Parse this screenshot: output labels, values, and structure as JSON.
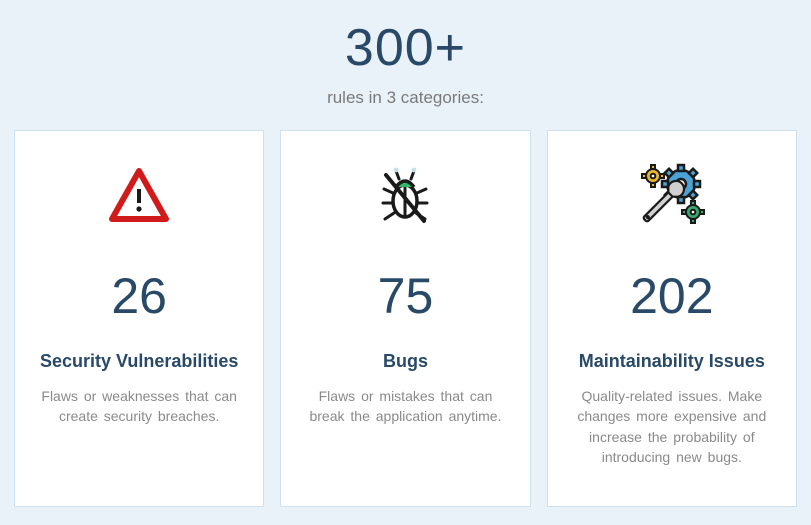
{
  "header": {
    "total": "300+",
    "subtitle": "rules in 3 categories:"
  },
  "cards": [
    {
      "icon": "warning-triangle-icon",
      "count": "26",
      "title": "Security Vulnerabilities",
      "desc": "Flaws or weaknesses that can create security breaches."
    },
    {
      "icon": "bug-crossed-icon",
      "count": "75",
      "title": "Bugs",
      "desc": "Flaws or mistakes that can break the application anytime."
    },
    {
      "icon": "wrench-gears-icon",
      "count": "202",
      "title": "Maintainability Issues",
      "desc": "Quality-related issues. Make changes more expensive and increase the probability of introducing new bugs."
    }
  ]
}
